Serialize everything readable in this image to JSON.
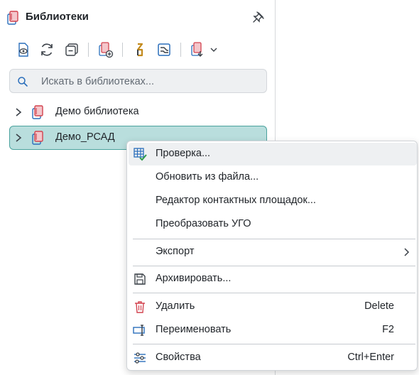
{
  "panel": {
    "title": "Библиотеки",
    "title_icon": "library-book-icon",
    "pin_icon": "pin-icon"
  },
  "toolbar": {
    "buttons": [
      {
        "name": "view-library-button",
        "icon": "eye-document-icon"
      },
      {
        "name": "refresh-button",
        "icon": "refresh-icon"
      },
      {
        "name": "collapse-all-button",
        "icon": "collapse-icon"
      },
      {
        "name": "add-library-button",
        "icon": "add-library-icon"
      },
      {
        "name": "symbol-editor-button",
        "icon": "symbol-icon"
      },
      {
        "name": "footprint-editor-button",
        "icon": "footprint-icon"
      },
      {
        "name": "import-menu-button",
        "icon": "import-library-icon"
      }
    ]
  },
  "search": {
    "placeholder": "Искать в библиотеках..."
  },
  "tree": {
    "items": [
      {
        "label": "Демо библиотека",
        "selected": false
      },
      {
        "label": "Демо_РСАД",
        "selected": true
      }
    ]
  },
  "context_menu": {
    "items": [
      {
        "label": "Проверка...",
        "icon": "check-table-icon",
        "shortcut": "",
        "hover": true
      },
      {
        "label": "Обновить из файла...",
        "icon": "",
        "shortcut": ""
      },
      {
        "label": "Редактор контактных площадок...",
        "icon": "",
        "shortcut": ""
      },
      {
        "label": "Преобразовать УГО",
        "icon": "",
        "shortcut": ""
      },
      {
        "label": "Экспорт",
        "icon": "",
        "shortcut": "",
        "submenu": true
      },
      {
        "label": "Архивировать...",
        "icon": "save-icon",
        "shortcut": ""
      },
      {
        "label": "Удалить",
        "icon": "trash-icon",
        "shortcut": "Delete"
      },
      {
        "label": "Переименовать",
        "icon": "rename-icon",
        "shortcut": "F2"
      },
      {
        "label": "Свойства",
        "icon": "properties-icon",
        "shortcut": "Ctrl+Enter"
      }
    ]
  },
  "colors": {
    "accent": "#4aa29d",
    "selection": "#b9dedd",
    "library_icon": "#d2434f",
    "icon_blue": "#2a6ebb",
    "hover": "#eef0f2"
  }
}
